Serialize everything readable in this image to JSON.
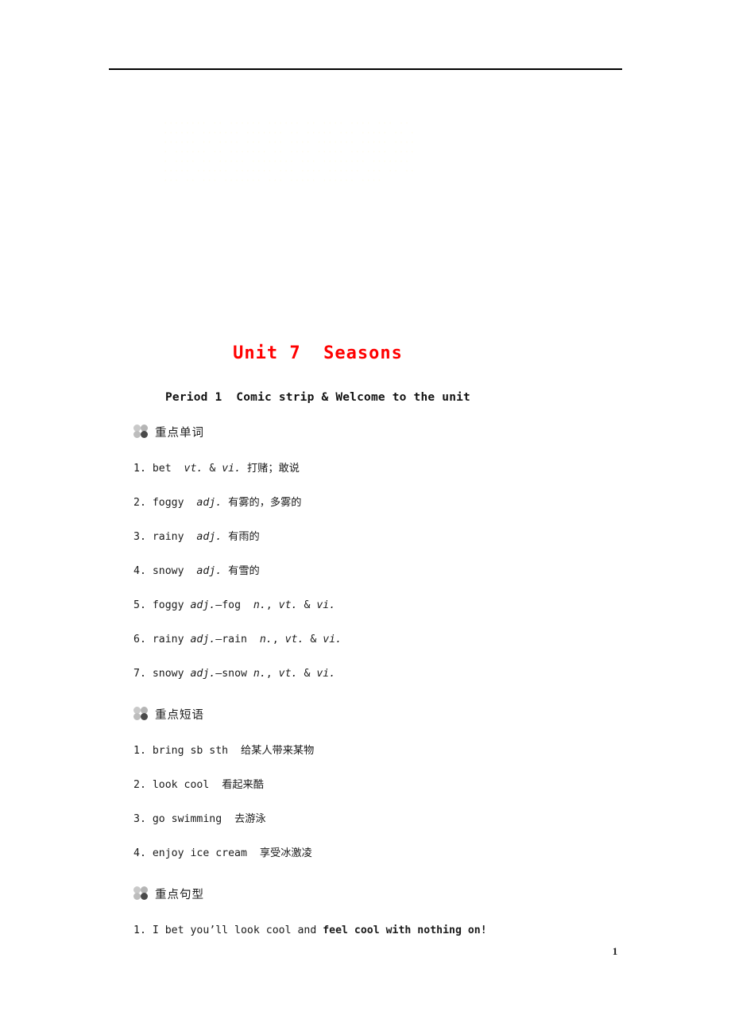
{
  "document": {
    "title": "Unit 7  Seasons",
    "title_color": "#ff0000",
    "subtitle": "Period 1  Comic strip & Welcome to the unit",
    "page_number": "1",
    "watermark_text": "········ ·· ······ ······ ·· ···· ···· ··· ·· ······ ······· ······· ·· ····· ··· ····· ·· ······· ·· ···· ··· ··· ···· ······· ····· ····· ······ ·· ······· ·· ···· ····· ······· ····· ···· ·· ····· ········ ··· ········ ······· ····· ······ ······· ··· ···· ······ ··· ·· ····· ·· ··· ······· ··· ····· ······ ····"
  },
  "sections": [
    {
      "icon": "clover-icon",
      "title": "重点单词",
      "entries": [
        {
          "prefix": "1.",
          "lines": [
            {
              "t": "bet  ",
              "s": "plain"
            },
            {
              "t": "vt.",
              "s": "italic"
            },
            {
              "t": " & ",
              "s": "plain"
            },
            {
              "t": "vi.",
              "s": "italic"
            },
            {
              "t": " ",
              "s": "plain"
            },
            {
              "t": "打赌；敢说",
              "s": "cn"
            }
          ]
        },
        {
          "prefix": "2.",
          "lines": [
            {
              "t": "foggy  ",
              "s": "plain"
            },
            {
              "t": "adj.",
              "s": "italic"
            },
            {
              "t": " ",
              "s": "plain"
            },
            {
              "t": "有雾的，多雾的",
              "s": "cn"
            }
          ]
        },
        {
          "prefix": "3.",
          "lines": [
            {
              "t": "rainy  ",
              "s": "plain"
            },
            {
              "t": "adj.",
              "s": "italic"
            },
            {
              "t": " ",
              "s": "plain"
            },
            {
              "t": "有雨的",
              "s": "cn"
            }
          ]
        },
        {
          "prefix": "4.",
          "lines": [
            {
              "t": "snowy  ",
              "s": "plain"
            },
            {
              "t": "adj.",
              "s": "italic"
            },
            {
              "t": " ",
              "s": "plain"
            },
            {
              "t": "有雪的",
              "s": "cn"
            }
          ]
        },
        {
          "prefix": "5.",
          "lines": [
            {
              "t": "foggy ",
              "s": "plain"
            },
            {
              "t": "adj.",
              "s": "italic"
            },
            {
              "t": "—fog  ",
              "s": "plain"
            },
            {
              "t": "n.",
              "s": "italic"
            },
            {
              "t": ", ",
              "s": "plain"
            },
            {
              "t": "vt.",
              "s": "italic"
            },
            {
              "t": " & ",
              "s": "plain"
            },
            {
              "t": "vi.",
              "s": "italic"
            }
          ]
        },
        {
          "prefix": "6.",
          "lines": [
            {
              "t": "rainy ",
              "s": "plain"
            },
            {
              "t": "adj.",
              "s": "italic"
            },
            {
              "t": "—rain  ",
              "s": "plain"
            },
            {
              "t": "n.",
              "s": "italic"
            },
            {
              "t": ", ",
              "s": "plain"
            },
            {
              "t": "vt.",
              "s": "italic"
            },
            {
              "t": " & ",
              "s": "plain"
            },
            {
              "t": "vi.",
              "s": "italic"
            }
          ]
        },
        {
          "prefix": "7.",
          "lines": [
            {
              "t": "snowy ",
              "s": "plain"
            },
            {
              "t": "adj.",
              "s": "italic"
            },
            {
              "t": "—snow ",
              "s": "plain"
            },
            {
              "t": "n.",
              "s": "italic"
            },
            {
              "t": ", ",
              "s": "plain"
            },
            {
              "t": "vt.",
              "s": "italic"
            },
            {
              "t": " & ",
              "s": "plain"
            },
            {
              "t": "vi.",
              "s": "italic"
            }
          ]
        }
      ]
    },
    {
      "icon": "clover-icon",
      "title": "重点短语",
      "entries": [
        {
          "prefix": "1.",
          "lines": [
            {
              "t": "bring sb sth  ",
              "s": "plain"
            },
            {
              "t": "给某人带来某物",
              "s": "cn"
            }
          ]
        },
        {
          "prefix": "2.",
          "lines": [
            {
              "t": "look cool  ",
              "s": "plain"
            },
            {
              "t": "看起来酷",
              "s": "cn"
            }
          ]
        },
        {
          "prefix": "3.",
          "lines": [
            {
              "t": "go swimming  ",
              "s": "plain"
            },
            {
              "t": "去游泳",
              "s": "cn"
            }
          ]
        },
        {
          "prefix": "4.",
          "lines": [
            {
              "t": "enjoy ice cream  ",
              "s": "plain"
            },
            {
              "t": "享受冰激凌",
              "s": "cn"
            }
          ]
        }
      ]
    },
    {
      "icon": "clover-icon",
      "title": "重点句型",
      "entries": [
        {
          "prefix": "1.",
          "lines": [
            {
              "t": "I bet you’ll look cool and ",
              "s": "plain"
            },
            {
              "t": "feel cool with nothing on!",
              "s": "bold"
            }
          ]
        }
      ]
    }
  ]
}
